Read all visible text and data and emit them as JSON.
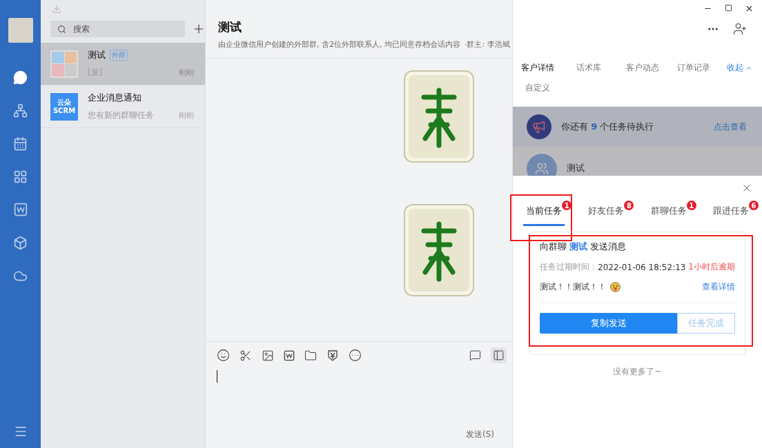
{
  "nav": {
    "items": [
      {
        "kind": "chat",
        "selected": true
      },
      {
        "kind": "org",
        "selected": false
      },
      {
        "kind": "calendar",
        "selected": false
      },
      {
        "kind": "apps",
        "selected": false
      },
      {
        "kind": "doc",
        "selected": false
      },
      {
        "kind": "cube",
        "selected": false
      },
      {
        "kind": "cloud",
        "selected": false
      }
    ]
  },
  "chat_list": {
    "search": {
      "placeholder": "搜索"
    },
    "items": [
      {
        "kind": "group",
        "name": "测试",
        "tag": "外部",
        "preview": "[发]",
        "time": "刚刚",
        "selected": true
      },
      {
        "kind": "logo",
        "logo_lines": [
          "云朵",
          "SCRM"
        ],
        "name": "企业消息通知",
        "preview": "您有新的群聊任务",
        "time": "刚刚",
        "selected": false
      }
    ]
  },
  "chat": {
    "title": "测试",
    "subtitle": "由企业微信用户创建的外部群, 含2位外部联系人, 均已同意存档会话内容",
    "owner": "·群主: 李浩斌",
    "messages": [
      {
        "kind": "sticker"
      },
      {
        "kind": "sticker"
      }
    ],
    "send_label": "发送(S)"
  },
  "panel": {
    "tabs": [
      {
        "label": "客户详情",
        "selected": true
      },
      {
        "label": "话术库",
        "selected": false
      },
      {
        "label": "客户动态",
        "selected": false
      },
      {
        "label": "订单记录",
        "selected": false
      },
      {
        "label": "自定义",
        "selected": false
      }
    ],
    "collapse": "收起",
    "notice": {
      "before": "你还有",
      "count": "9",
      "after": "个任务待执行",
      "link": "点击查看"
    },
    "contact": "测试"
  },
  "task_sheet": {
    "tabs": [
      {
        "label": "当前任务",
        "badge": "1",
        "selected": true
      },
      {
        "label": "好友任务",
        "badge": "8",
        "selected": false
      },
      {
        "label": "群聊任务",
        "badge": "1",
        "selected": false
      },
      {
        "label": "跟进任务",
        "badge": "6",
        "selected": false
      }
    ],
    "card": {
      "title_prefix": "向群聊",
      "title_target": "测试",
      "title_suffix": "发送消息",
      "expiry_label": "任务过期时间：",
      "expiry_time": "2022-01-06 18:52:13",
      "overdue": "1小时后逾期",
      "message": "测试！！测试！！",
      "detail_link": "查看详情",
      "primary_button": "复制发送",
      "secondary_button": "任务完成"
    },
    "footer": "没有更多了~"
  }
}
